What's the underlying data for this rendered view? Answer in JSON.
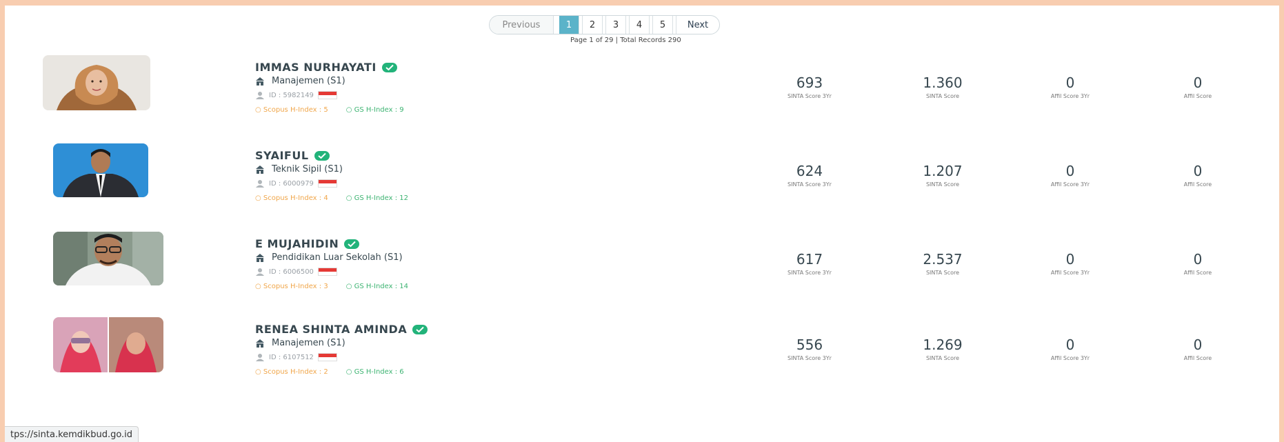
{
  "pagination": {
    "previous": "Previous",
    "pages": [
      "1",
      "2",
      "3",
      "4",
      "5"
    ],
    "active": "1",
    "next": "Next",
    "info": "Page 1 of 29 | Total Records 290"
  },
  "labels": {
    "sinta_3yr": "SINTA Score 3Yr",
    "sinta": "SINTA Score",
    "affil_3yr": "Affil Score 3Yr",
    "affil": "Affil Score"
  },
  "authors": [
    {
      "name": "IMMAS NURHAYATI",
      "dept": "Manajemen (S1)",
      "id": "ID : 5982149",
      "scopus": "Scopus H-Index : 5",
      "gs": "GS H-Index : 9",
      "sinta_3yr": "693",
      "sinta": "1.360",
      "affil_3yr": "0",
      "affil": "0"
    },
    {
      "name": "SYAIFUL",
      "dept": "Teknik Sipil (S1)",
      "id": "ID : 6000979",
      "scopus": "Scopus H-Index : 4",
      "gs": "GS H-Index : 12",
      "sinta_3yr": "624",
      "sinta": "1.207",
      "affil_3yr": "0",
      "affil": "0"
    },
    {
      "name": "E MUJAHIDIN",
      "dept": "Pendidikan Luar Sekolah (S1)",
      "id": "ID : 6006500",
      "scopus": "Scopus H-Index : 3",
      "gs": "GS H-Index : 14",
      "sinta_3yr": "617",
      "sinta": "2.537",
      "affil_3yr": "0",
      "affil": "0"
    },
    {
      "name": "RENEA SHINTA AMINDA",
      "dept": "Manajemen (S1)",
      "id": "ID : 6107512",
      "scopus": "Scopus H-Index : 2",
      "gs": "GS H-Index : 6",
      "sinta_3yr": "556",
      "sinta": "1.269",
      "affil_3yr": "0",
      "affil": "0"
    }
  ],
  "status_bar_url": "tps://sinta.kemdikbud.go.id",
  "colors": {
    "page_border": "#f8cdb0",
    "active_page": "#5bb3c9",
    "verified": "#22b37a",
    "scopus": "#f0a64a",
    "gs": "#3cb371"
  }
}
